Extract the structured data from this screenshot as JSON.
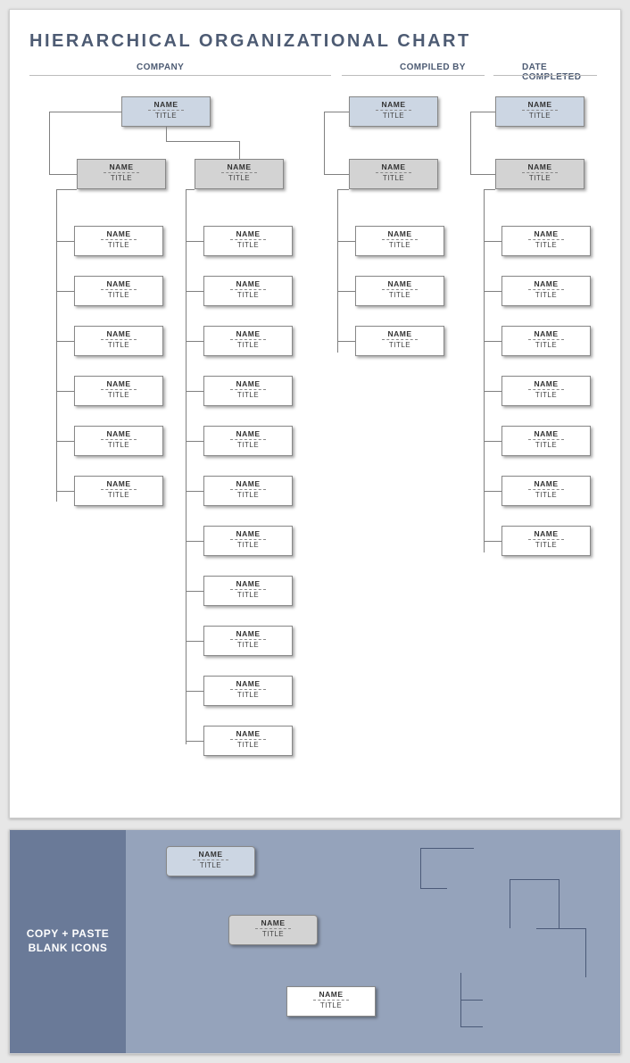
{
  "title": "HIERARCHICAL ORGANIZATIONAL CHART",
  "headers": {
    "company": "COMPANY",
    "compiled_by": "COMPILED BY",
    "date_completed": "DATE COMPLETED"
  },
  "labels": {
    "name": "NAME",
    "title": "TITLE"
  },
  "panel2": {
    "heading": "COPY + PASTE\nBLANK ICONS"
  }
}
